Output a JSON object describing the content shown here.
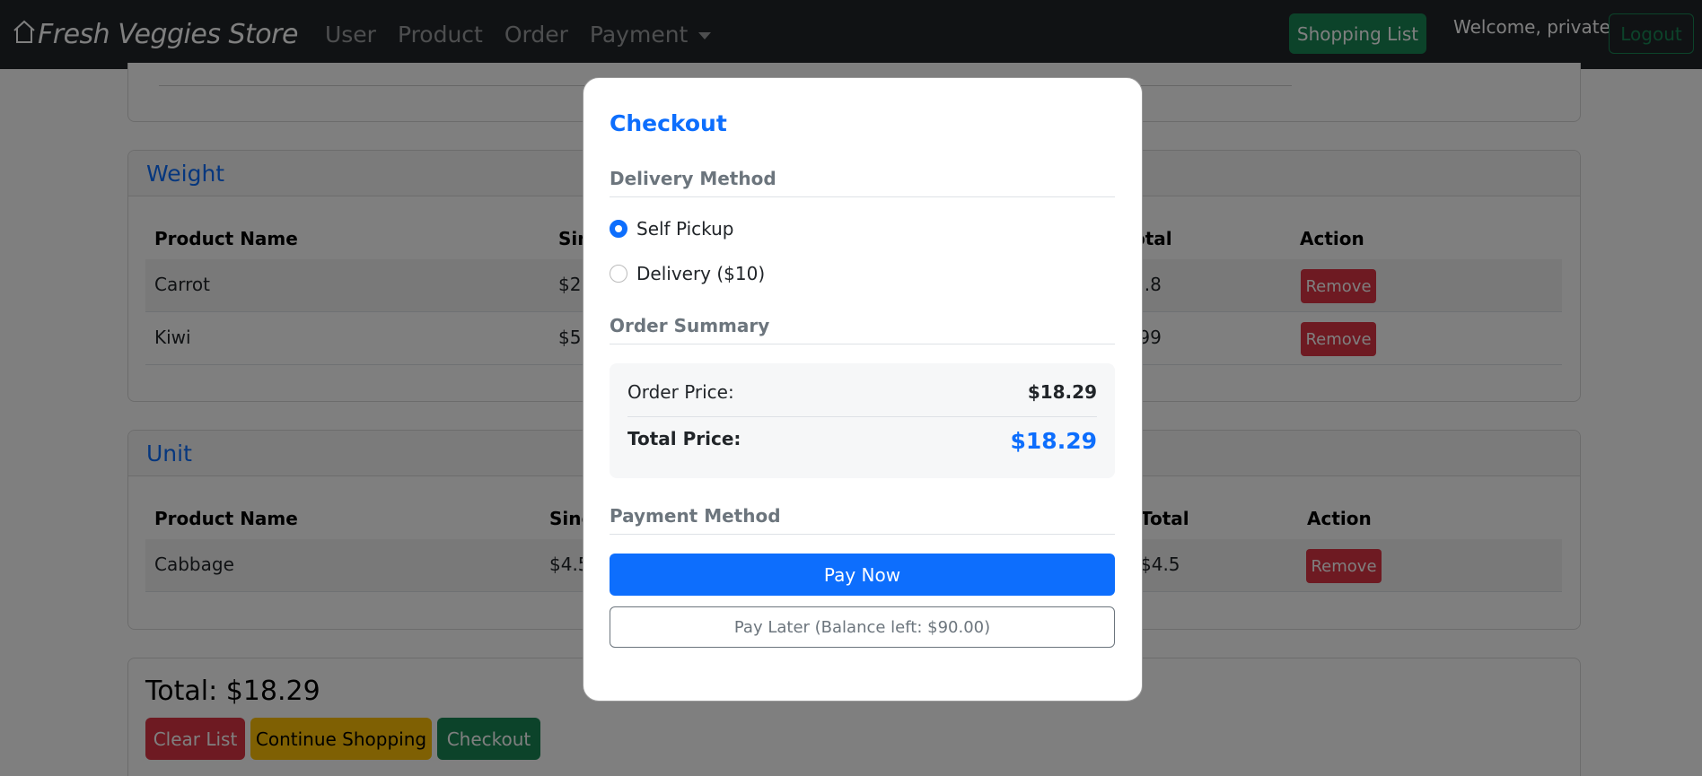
{
  "navbar": {
    "brand": "Fresh Veggies Store",
    "links": [
      "User",
      "Product",
      "Order",
      "Payment"
    ],
    "shopping_list": "Shopping List",
    "welcome": "Welcome, private",
    "logout": "Logout"
  },
  "weight_section": {
    "title": "Weight",
    "headers": [
      "Product Name",
      "Sin",
      "otal",
      "Action"
    ],
    "rows": [
      {
        "name": "Carrot",
        "single": "$2.",
        "total": "2.8",
        "action": "Remove"
      },
      {
        "name": "Kiwi",
        "single": "$5.",
        "total": ".99",
        "action": "Remove"
      }
    ]
  },
  "unit_section": {
    "title": "Unit",
    "headers": [
      "Product Name",
      "Sing",
      "Total",
      "Action"
    ],
    "rows": [
      {
        "name": "Cabbage",
        "single": "$4.5",
        "total": "$4.5",
        "action": "Remove"
      }
    ]
  },
  "footer": {
    "total": "Total: $18.29",
    "clear": "Clear List",
    "continue": "Continue Shopping",
    "checkout": "Checkout"
  },
  "modal": {
    "title": "Checkout",
    "delivery_title": "Delivery Method",
    "option_pickup": "Self Pickup",
    "option_delivery": "Delivery ($10)",
    "summary_title": "Order Summary",
    "order_price_label": "Order Price:",
    "order_price_value": "$18.29",
    "total_price_label": "Total Price:",
    "total_price_value": "$18.29",
    "payment_title": "Payment Method",
    "pay_now": "Pay Now",
    "pay_later": "Pay Later (Balance left: $90.00)"
  },
  "colors": {
    "primary": "#0d6efd",
    "success": "#198754",
    "danger": "#dc3545",
    "warning": "#ffc107",
    "navbar": "#212529"
  },
  "icons": {
    "brand": "house-icon",
    "payment_dropdown": "caret-down-icon"
  }
}
